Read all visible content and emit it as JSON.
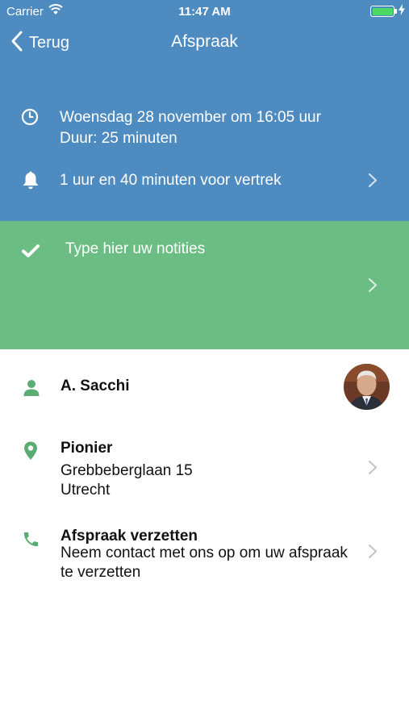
{
  "status_bar": {
    "carrier": "Carrier",
    "time": "11:47 AM"
  },
  "nav": {
    "back_label": "Terug",
    "title": "Afspraak"
  },
  "appointment": {
    "date_line": "Woensdag 28 november om 16:05 uur",
    "duration_line": "Duur: 25 minuten",
    "reminder_line": "1 uur en 40 minuten voor vertrek"
  },
  "notes": {
    "placeholder": "Type hier uw notities"
  },
  "contact": {
    "name": "A. Sacchi"
  },
  "location": {
    "title": "Pionier",
    "street": "Grebbeberglaan 15",
    "city": "Utrecht"
  },
  "reschedule": {
    "title": "Afspraak verzetten",
    "line1": "Neem contact met ons op om uw afspraak",
    "line2": "te verzetten"
  },
  "colors": {
    "header_blue": "#4d8bc1",
    "notes_green": "#6bbd83",
    "icon_green": "#5aac72",
    "chevron_grey": "#c4c4c4"
  }
}
